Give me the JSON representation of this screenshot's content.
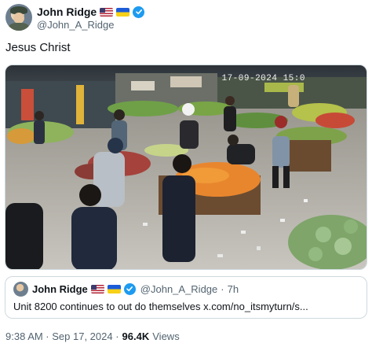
{
  "author": {
    "name": "John Ridge",
    "handle": "@John_A_Ridge",
    "avatar_icon": "profile-avatar",
    "flags": [
      "us-flag-icon",
      "ukraine-flag-icon"
    ],
    "verified_icon": "verified-badge-icon",
    "verified_color": "#1d9bf0"
  },
  "tweet": {
    "text": "Jesus Christ",
    "media": {
      "kind": "cctv-video-still",
      "camera_timestamp": "17-09-2024 15:0"
    }
  },
  "quote": {
    "name": "John Ridge",
    "handle": "@John_A_Ridge",
    "separator": "·",
    "time": "7h",
    "text": "Unit 8200 continues to out do themselves x.com/no_itsmyturn/s..."
  },
  "footer": {
    "timestamp": "9:38 AM · Sep 17, 2024 ·",
    "views_count": "96.4K",
    "views_label": "Views"
  },
  "colors": {
    "text_primary": "#0f1419",
    "text_secondary": "#536471",
    "border": "#cfd9de"
  }
}
